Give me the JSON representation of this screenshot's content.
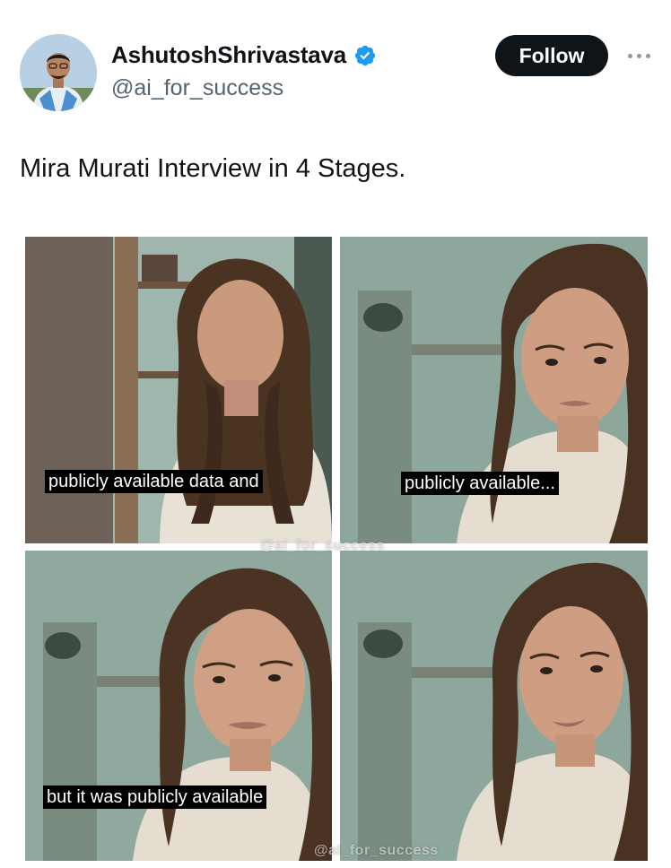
{
  "author": {
    "display_name": "AshutoshShrivastava",
    "handle": "@ai_for_success",
    "verified": true,
    "avatar_icon": "user-avatar"
  },
  "actions": {
    "follow_label": "Follow",
    "more_icon": "more-horizontal-icon"
  },
  "post": {
    "text": "Mira Murati Interview in 4 Stages."
  },
  "media": {
    "panels": [
      {
        "caption": "publicly available data and"
      },
      {
        "caption": "publicly available..."
      },
      {
        "caption": "but it was publicly available"
      },
      {
        "caption": ""
      }
    ],
    "watermarks": [
      "@ai_for_success",
      "@ai_for_success"
    ]
  },
  "colors": {
    "verified_badge": "#1d9bf0",
    "follow_button_bg": "#0f1419",
    "follow_button_text": "#ffffff",
    "handle_text": "#536471",
    "caption_bg": "#000000",
    "caption_text": "#ffffff"
  }
}
